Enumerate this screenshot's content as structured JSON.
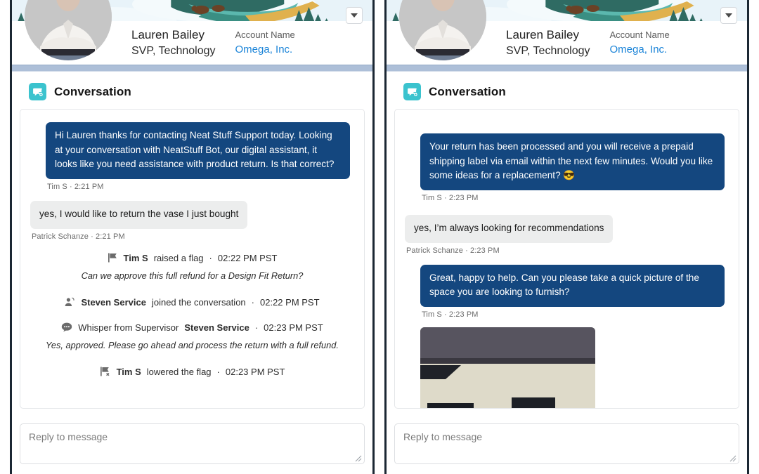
{
  "header": {
    "person_name": "Lauren Bailey",
    "person_title": "SVP, Technology",
    "account_label": "Account Name",
    "account_value": "Omega, Inc.",
    "menu_icon": "chevron-down-icon"
  },
  "section": {
    "icon": "conversation-icon",
    "title": "Conversation"
  },
  "reply": {
    "placeholder": "Reply to message"
  },
  "colors": {
    "agent_bubble": "#14477f",
    "customer_bubble": "#eceded",
    "accent_teal": "#3bc3ce",
    "link_blue": "#1b84d8",
    "divider_blue": "#adbfd8",
    "panel_border": "#1b2733"
  },
  "left_panel": {
    "messages": [
      {
        "kind": "bubble",
        "side": "agent",
        "text": "Hi Lauren thanks for contacting Neat Stuff Support today. Looking at your conversation with NeatStuff Bot, our digital assistant, it looks like you need assistance with product return. Is that correct?",
        "meta": "Tim S · 2:21 PM"
      },
      {
        "kind": "bubble",
        "side": "customer",
        "text": "yes, I would like to return the vase I just bought",
        "meta": "Patrick Schanze · 2:21 PM"
      },
      {
        "kind": "event",
        "icon": "flag-raised-icon",
        "actor": "Tim S",
        "action": "raised a flag",
        "separator": "·",
        "time": "02:22 PM PST",
        "note": "Can we approve this full refund for a Design Fit Return?"
      },
      {
        "kind": "event",
        "icon": "person-join-icon",
        "actor": "Steven Service",
        "action": "joined the conversation",
        "separator": "·",
        "time": "02:22 PM PST",
        "note": ""
      },
      {
        "kind": "event",
        "icon": "whisper-icon",
        "prefix": "Whisper from Supervisor",
        "actor": "Steven Service",
        "action": "",
        "separator": "·",
        "time": "02:23 PM PST",
        "note": "Yes, approved. Please go ahead and process the return with a full refund."
      },
      {
        "kind": "event",
        "icon": "flag-lowered-icon",
        "actor": "Tim S",
        "action": "lowered the flag",
        "separator": "·",
        "time": "02:23 PM PST",
        "note": ""
      }
    ]
  },
  "right_panel": {
    "messages": [
      {
        "kind": "bubble",
        "side": "agent",
        "text": "Your return has been processed and you will receive a prepaid shipping label via email within the next few minutes. Would you like some ideas for a replacement? 😎",
        "meta": "Tim S · 2:23 PM"
      },
      {
        "kind": "bubble",
        "side": "customer",
        "text": "yes, I’m always looking for recommendations",
        "meta": "Patrick Schanze · 2:23 PM"
      },
      {
        "kind": "bubble",
        "side": "agent",
        "text": "Great, happy to help. Can you please take a quick picture of the space you are looking to furnish?",
        "meta": "Tim S · 2:23 PM"
      },
      {
        "kind": "photo",
        "alt": "attached-room-photo"
      }
    ]
  }
}
